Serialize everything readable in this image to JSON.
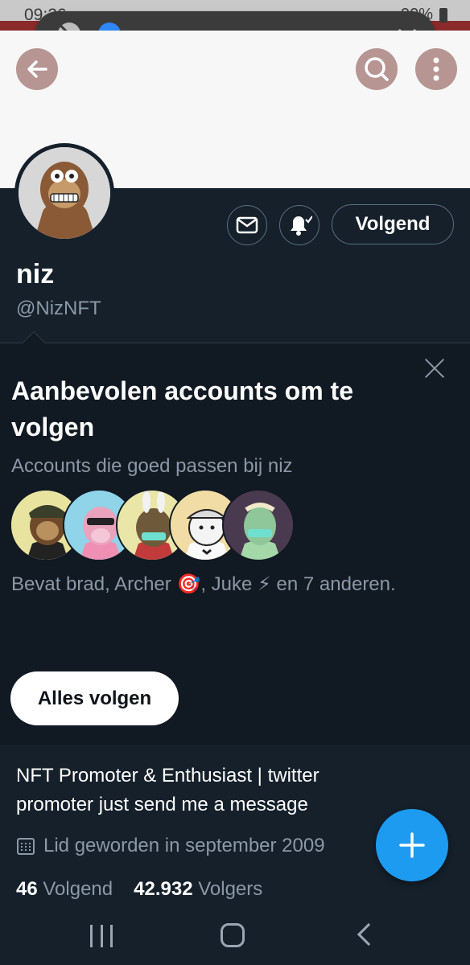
{
  "status_bar": {
    "time": "09:26",
    "battery": "90%"
  },
  "media_overlay": {
    "volume_level": 0.05
  },
  "header": {
    "back_icon": "arrow-left-icon",
    "search_icon": "search-icon",
    "more_icon": "more-vertical-icon"
  },
  "profile": {
    "display_name": "niz",
    "handle": "@NizNFT",
    "following_button_label": "Volgend",
    "message_icon": "envelope-icon",
    "notify_icon": "bell-check-icon"
  },
  "recommended": {
    "title": "Aanbevolen accounts om te volgen",
    "subtitle": "Accounts die goed passen bij niz",
    "description": "Bevat brad, Archer 🎯, Juke ⚡ en 7 anderen.",
    "follow_all_label": "Alles volgen",
    "avatar_colors": [
      "#e8e4a0",
      "#8fd4e8",
      "#e9e6a8",
      "#f2dca6",
      "#4a3a4f"
    ]
  },
  "bio": {
    "text": "NFT Promoter & Enthusiast | twitter promoter just send me a message",
    "joined": "Lid geworden in september 2009",
    "following_count": "46",
    "following_label": "Volgend",
    "followers_count": "42.932",
    "followers_label": "Volgers"
  },
  "colors": {
    "background": "#15202b",
    "accent": "#1d9bf0"
  }
}
